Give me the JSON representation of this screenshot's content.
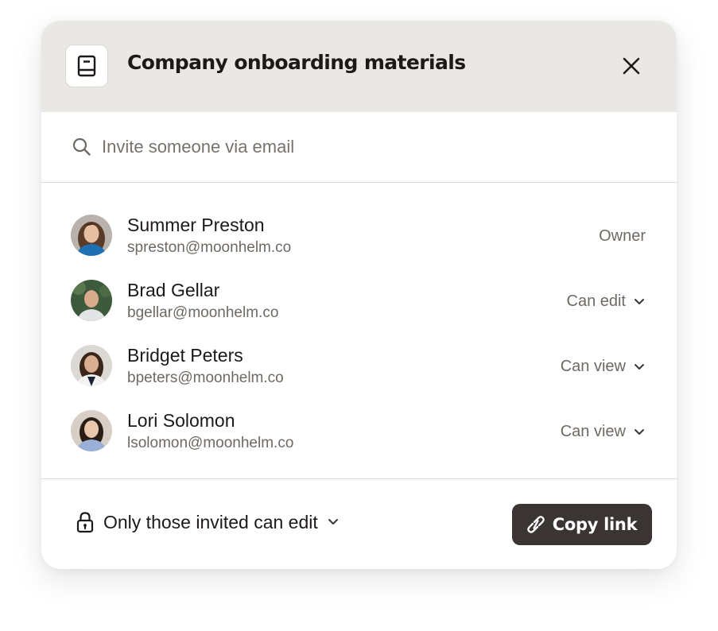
{
  "header": {
    "title": "Company onboarding materials",
    "doc_icon": "document-icon",
    "close_icon": "close-icon"
  },
  "search": {
    "placeholder": "Invite someone via email",
    "value": ""
  },
  "people": [
    {
      "name": "Summer Preston",
      "email": "spreston@moonhelm.co",
      "role": "Owner",
      "role_editable": false
    },
    {
      "name": "Brad Gellar",
      "email": "bgellar@moonhelm.co",
      "role": "Can edit",
      "role_editable": true
    },
    {
      "name": "Bridget Peters",
      "email": "bpeters@moonhelm.co",
      "role": "Can view",
      "role_editable": true
    },
    {
      "name": "Lori Solomon",
      "email": "lsolomon@moonhelm.co",
      "role": "Can view",
      "role_editable": true
    }
  ],
  "footer": {
    "access_label": "Only those invited can edit",
    "copy_link_label": "Copy link"
  },
  "colors": {
    "header_bg": "#eae8e4",
    "primary_button": "#3a3532",
    "text": "#1e1919",
    "muted_text": "#6f6963"
  }
}
